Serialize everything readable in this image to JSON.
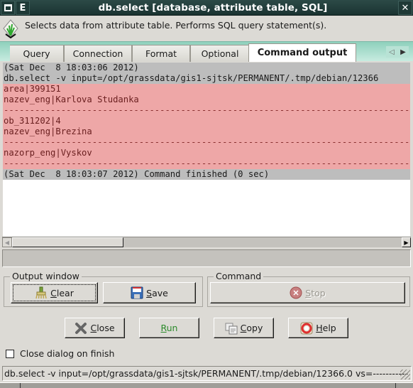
{
  "window": {
    "title": "db.select [database, attribute table, SQL]",
    "menu_button_label": "E",
    "close_glyph": "✕"
  },
  "description": {
    "text": "Selects data from attribute table. Performs SQL query statement(s).",
    "icon": "grass-logo-icon"
  },
  "tabs": [
    {
      "label": "Query",
      "active": false
    },
    {
      "label": "Connection",
      "active": false
    },
    {
      "label": "Format",
      "active": false
    },
    {
      "label": "Optional",
      "active": false
    },
    {
      "label": "Command output",
      "active": true
    }
  ],
  "output": {
    "lines": [
      {
        "text": "(Sat Dec  8 18:03:06 2012)",
        "style": "gray"
      },
      {
        "text": "db.select -v input=/opt/grassdata/gis1-sjtsk/PERMANENT/.tmp/debian/12366",
        "style": "gray"
      },
      {
        "text": "area|399151",
        "style": "red"
      },
      {
        "text": "nazev_eng|Karlova Studanka",
        "style": "red"
      },
      {
        "text": "------------------------------------------------------------------------------",
        "style": "red dash"
      },
      {
        "text": "ob_311202|4",
        "style": "red"
      },
      {
        "text": "nazev_eng|Brezina",
        "style": "red"
      },
      {
        "text": "------------------------------------------------------------------------------",
        "style": "red dash"
      },
      {
        "text": "nazorp_eng|Vyskov",
        "style": "red"
      },
      {
        "text": "------------------------------------------------------------------------------",
        "style": "red dash"
      },
      {
        "text": "(Sat Dec  8 18:03:07 2012) Command finished (0 sec)",
        "style": "gray"
      }
    ]
  },
  "output_window": {
    "label": "Output window",
    "clear_label": "lear",
    "clear_mnemonic": "C",
    "save_label": "ave",
    "save_mnemonic": "S"
  },
  "command": {
    "label": "Command",
    "stop_label": "top",
    "stop_mnemonic": "S"
  },
  "actions": {
    "close_mnemonic": "C",
    "close_label": "lose",
    "run_mnemonic": "R",
    "run_label": "un",
    "copy_mnemonic": "C",
    "copy_label": "opy",
    "help_mnemonic": "H",
    "help_label": "elp"
  },
  "close_on_finish": {
    "label": "Close dialog on finish",
    "checked": false
  },
  "statusbar": {
    "text": "db.select -v input=/opt/grassdata/gis1-sjtsk/PERMANENT/.tmp/debian/12366.0 vs=-----------"
  },
  "colors": {
    "titlebar": "#1f3a37",
    "tabbar": "#a8dccb",
    "output_gray": "#bdbdbd",
    "output_red": "#eea7a7",
    "run_text": "#2a8a2a"
  }
}
